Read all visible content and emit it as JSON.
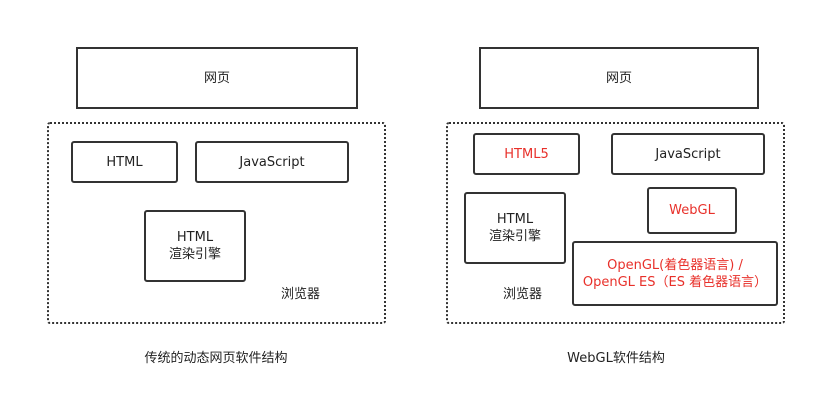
{
  "left": {
    "page_label": "网页",
    "html_label": "HTML",
    "js_label": "JavaScript",
    "engine_line1": "HTML",
    "engine_line2": "渲染引擎",
    "browser_label": "浏览器",
    "caption": "传统的动态网页软件结构"
  },
  "right": {
    "page_label": "网页",
    "html5_label": "HTML5",
    "js_label": "JavaScript",
    "webgl_label": "WebGL",
    "engine_line1": "HTML",
    "engine_line2": "渲染引擎",
    "opengl_line1": "OpenGL(着色器语言) /",
    "opengl_line2": "OpenGL ES（ES 着色器语言）",
    "browser_label": "浏览器",
    "caption": "WebGL软件结构"
  },
  "colors": {
    "highlight": "#e8302a",
    "stroke": "#333333"
  }
}
